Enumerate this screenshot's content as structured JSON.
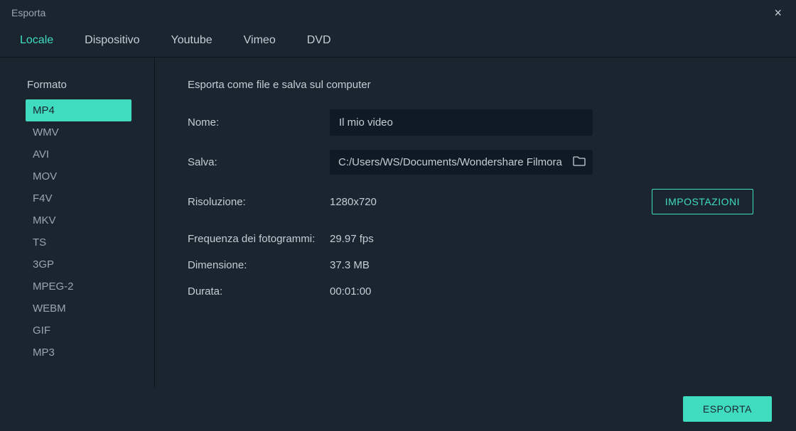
{
  "window": {
    "title": "Esporta"
  },
  "tabs": [
    {
      "label": "Locale",
      "active": true
    },
    {
      "label": "Dispositivo",
      "active": false
    },
    {
      "label": "Youtube",
      "active": false
    },
    {
      "label": "Vimeo",
      "active": false
    },
    {
      "label": "DVD",
      "active": false
    }
  ],
  "sidebar": {
    "title": "Formato",
    "formats": [
      "MP4",
      "WMV",
      "AVI",
      "MOV",
      "F4V",
      "MKV",
      "TS",
      "3GP",
      "MPEG-2",
      "WEBM",
      "GIF",
      "MP3"
    ],
    "active": "MP4"
  },
  "main": {
    "title": "Esporta come file e salva sul computer",
    "name_label": "Nome:",
    "name_value": "Il mio video",
    "save_label": "Salva:",
    "save_path": "C:/Users/WS/Documents/Wondershare Filmora",
    "resolution_label": "Risoluzione:",
    "resolution_value": "1280x720",
    "settings_button": "IMPOSTAZIONI",
    "fps_label": "Frequenza dei fotogrammi:",
    "fps_value": "29.97 fps",
    "size_label": "Dimensione:",
    "size_value": "37.3 MB",
    "duration_label": "Durata:",
    "duration_value": "00:01:00"
  },
  "footer": {
    "export_button": "ESPORTA"
  }
}
